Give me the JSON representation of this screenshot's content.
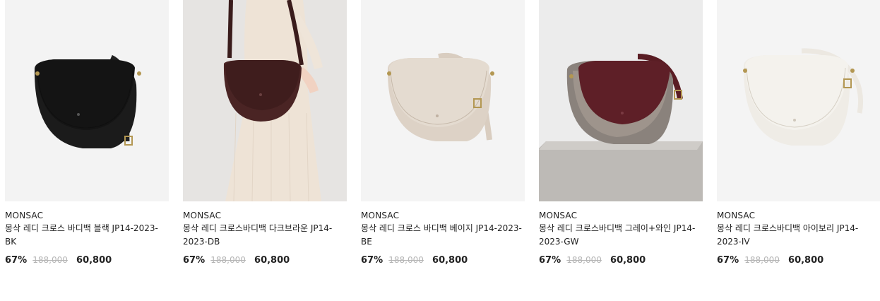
{
  "products": [
    {
      "brand": "MONSAC",
      "name": "몽삭 레디 크로스 바디백 블랙 JP14-2023-BK",
      "discount": "67%",
      "original_price": "188,000",
      "sale_price": "60,800",
      "bag_color": "#1b1b1b",
      "flap_color": "#141414",
      "strap_color": "#202020",
      "bg_color": "#f3f3f3"
    },
    {
      "brand": "MONSAC",
      "name": "몽삭 레디 크로스바디백 다크브라운 JP14-2023-DB",
      "discount": "67%",
      "original_price": "188,000",
      "sale_price": "60,800",
      "bag_color": "#4a2424",
      "flap_color": "#3f1d1d",
      "strap_color": "#3a1c1c",
      "bg_color": "#e6e4e2"
    },
    {
      "brand": "MONSAC",
      "name": "몽삭 레디 크로스 바디백 베이지 JP14-2023-BE",
      "discount": "67%",
      "original_price": "188,000",
      "sale_price": "60,800",
      "bag_color": "#ddd2c6",
      "flap_color": "#e4dbd0",
      "strap_color": "#d9cdc0",
      "bg_color": "#f4f4f4"
    },
    {
      "brand": "MONSAC",
      "name": "몽삭 레디 크로스바디백 그레이+와인 JP14-2023-GW",
      "discount": "67%",
      "original_price": "188,000",
      "sale_price": "60,800",
      "bag_color": "#8a827c",
      "flap_color": "#5e1f27",
      "strap_color": "#5a1d24",
      "bg_color": "#ececec"
    },
    {
      "brand": "MONSAC",
      "name": "몽삭 레디 크로스바디백 아이보리 JP14-2023-IV",
      "discount": "67%",
      "original_price": "188,000",
      "sale_price": "60,800",
      "bag_color": "#efece6",
      "flap_color": "#f4f2ed",
      "strap_color": "#ece8e1",
      "bg_color": "#f4f4f4"
    }
  ]
}
